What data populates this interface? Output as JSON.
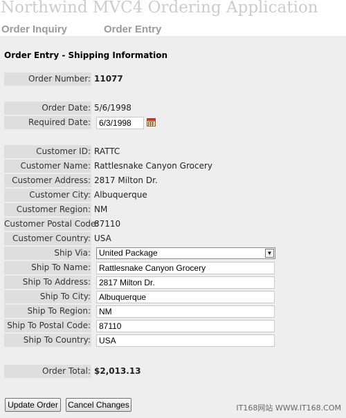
{
  "header": {
    "app_title": "Northwind MVC4 Ordering Application"
  },
  "nav": {
    "order_inquiry": "Order Inquiry",
    "order_entry": "Order Entry"
  },
  "section_title": "Order Entry - Shipping Information",
  "order": {
    "number_label": "Order Number:",
    "number": "11077",
    "date_label": "Order Date:",
    "date": "5/6/1998",
    "required_label": "Required Date:",
    "required": "6/3/1998"
  },
  "customer": {
    "id_label": "Customer ID:",
    "id": "RATTC",
    "name_label": "Customer Name:",
    "name": "Rattlesnake Canyon Grocery",
    "address_label": "Customer Address:",
    "address": "2817 Milton Dr.",
    "city_label": "Customer City:",
    "city": "Albuquerque",
    "region_label": "Customer Region:",
    "region": "NM",
    "postal_label": "Customer Postal Code:",
    "postal": "87110",
    "country_label": "Customer Country:",
    "country": "USA"
  },
  "shipping": {
    "via_label": "Ship Via:",
    "via": "United Package",
    "name_label": "Ship To Name:",
    "name": "Rattlesnake Canyon Grocery",
    "address_label": "Ship To Address:",
    "address": "2817 Milton Dr.",
    "city_label": "Ship To City:",
    "city": "Albuquerque",
    "region_label": "Ship To Region:",
    "region": "NM",
    "postal_label": "Ship To Postal Code:",
    "postal": "87110",
    "country_label": "Ship To Country:",
    "country": "USA"
  },
  "total": {
    "label": "Order Total:",
    "value": "$2,013.13"
  },
  "buttons": {
    "update": "Update Order",
    "cancel": "Cancel Changes"
  },
  "watermark": "IT168网站 WWW.IT168.COM",
  "icons": {
    "calendar": "calendar-icon",
    "dropdown": "chevron-down-icon"
  }
}
